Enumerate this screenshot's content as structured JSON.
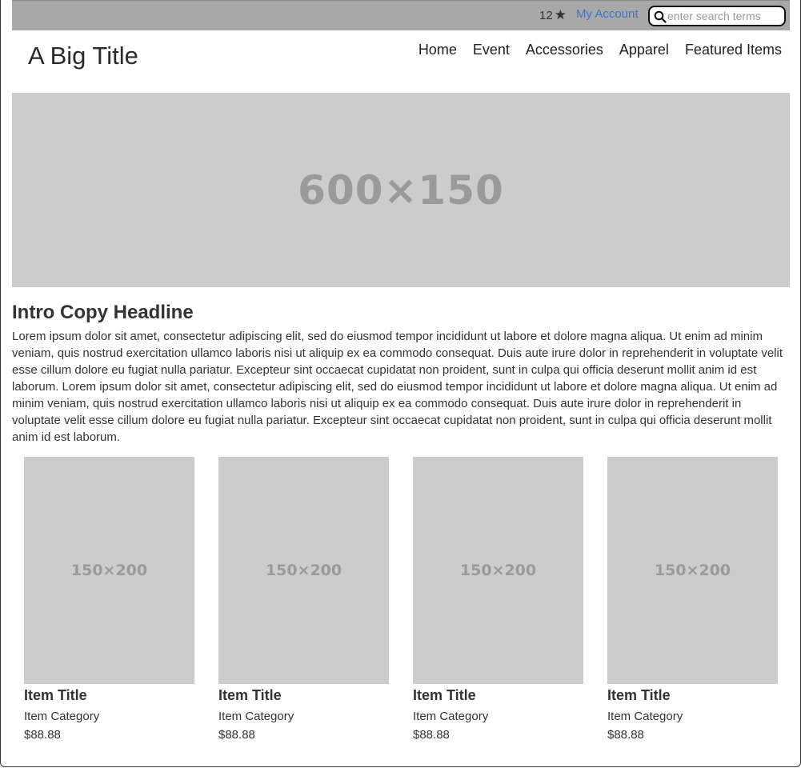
{
  "header": {
    "count": "12",
    "star": "★",
    "account_link": "My Account",
    "search_placeholder": "enter search terms"
  },
  "site": {
    "title": "A Big Title"
  },
  "nav": {
    "items": [
      "Home",
      "Event",
      "Accessories",
      "Apparel",
      "Featured Items"
    ]
  },
  "hero": {
    "placeholder_label": "600×150"
  },
  "intro": {
    "headline": "Intro Copy Headline",
    "body": "Lorem ipsum dolor sit amet, consectetur adipiscing elit, sed do eiusmod tempor incididunt ut labore et dolore magna aliqua. Ut enim ad minim veniam, quis nostrud exercitation ullamco laboris nisi ut aliquip ex ea commodo consequat. Duis aute irure dolor in reprehenderit in voluptate velit esse cillum dolore eu fugiat nulla pariatur. Excepteur sint occaecat cupidatat non proident, sunt in culpa qui officia deserunt mollit anim id est laborum. Lorem ipsum dolor sit amet, consectetur adipiscing elit, sed do eiusmod tempor incididunt ut labore et dolore magna aliqua. Ut enim ad minim veniam, quis nostrud exercitation ullamco laboris nisi ut aliquip ex ea commodo consequat. Duis aute irure dolor in reprehenderit in voluptate velit esse cillum dolore eu fugiat nulla pariatur. Excepteur sint occaecat cupidatat non proident, sunt in culpa qui officia deserunt mollit anim id est laborum."
  },
  "products": [
    {
      "image_label": "150×200",
      "title": "Item Title",
      "category": "Item Category",
      "price": "$88.88"
    },
    {
      "image_label": "150×200",
      "title": "Item Title",
      "category": "Item Category",
      "price": "$88.88"
    },
    {
      "image_label": "150×200",
      "title": "Item Title",
      "category": "Item Category",
      "price": "$88.88"
    },
    {
      "image_label": "150×200",
      "title": "Item Title",
      "category": "Item Category",
      "price": "$88.88"
    }
  ],
  "colors": {
    "topbar_bg": "#a8a8a8",
    "placeholder_bg": "#cccccc",
    "link": "#3a74c4"
  }
}
